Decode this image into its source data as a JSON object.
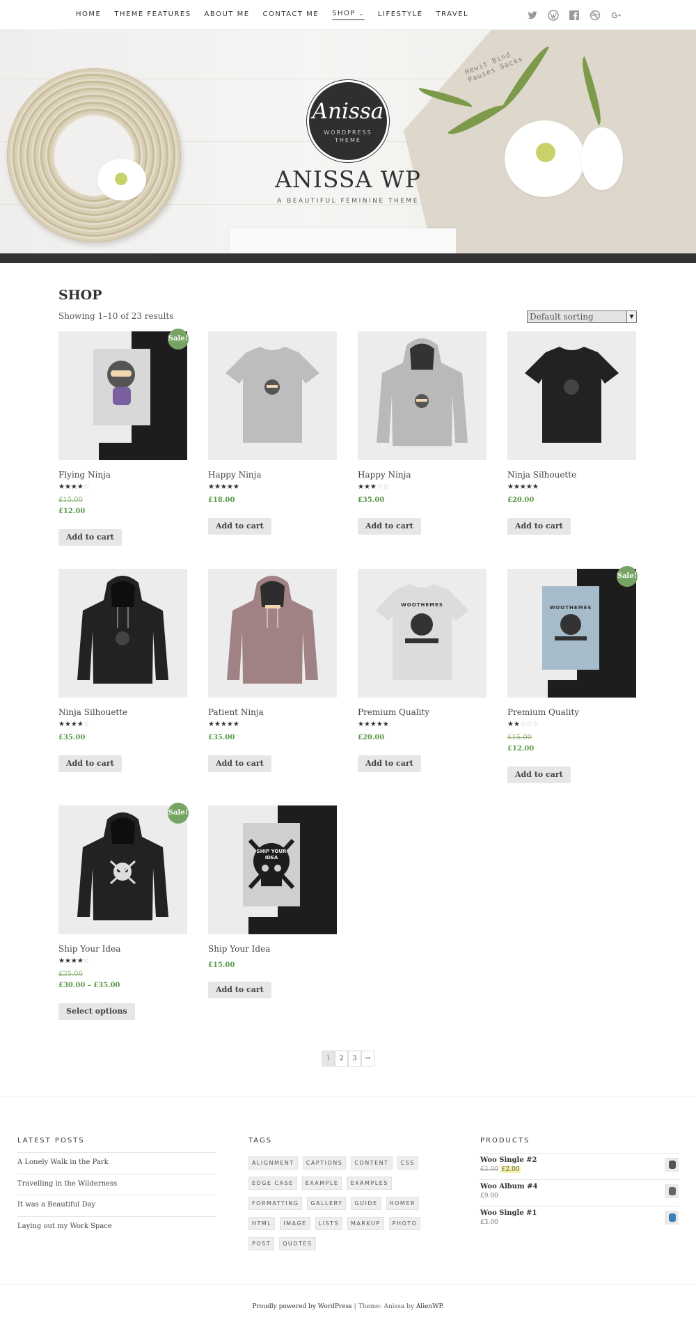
{
  "nav": {
    "items": [
      {
        "label": "HOME",
        "active": false
      },
      {
        "label": "THEME FEATURES",
        "active": false
      },
      {
        "label": "ABOUT ME",
        "active": false
      },
      {
        "label": "CONTACT ME",
        "active": false
      },
      {
        "label": "SHOP",
        "active": true,
        "has_dropdown": true
      },
      {
        "label": "LIFESTYLE",
        "active": false
      },
      {
        "label": "TRAVEL",
        "active": false
      }
    ],
    "social": [
      "twitter-icon",
      "wordpress-icon",
      "facebook-icon",
      "dribbble-icon",
      "google-plus-icon"
    ]
  },
  "hero": {
    "logo_name": "Anissa",
    "logo_sub_1": "WORDPRESS",
    "logo_sub_2": "THEME",
    "title": "ANISSA WP",
    "tagline": "A BEAUTIFUL FEMININE THEME",
    "cloth_line_1": "Hewit Bind",
    "cloth_line_2": "Pauses Sacks"
  },
  "shop": {
    "title": "SHOP",
    "result_count": "Showing 1–10 of 23 results",
    "sorting": "Default sorting",
    "products": [
      {
        "name": "Flying Ninja",
        "rating": 4,
        "price_old": "£15.00",
        "price": "£12.00",
        "button": "Add to cart",
        "sale": "Sale!",
        "art": "poster-ninja"
      },
      {
        "name": "Happy Ninja",
        "rating": 5,
        "price_old": "",
        "price": "£18.00",
        "button": "Add to cart",
        "sale": "",
        "art": "tshirt-grey"
      },
      {
        "name": "Happy Ninja",
        "rating": 3,
        "price_old": "",
        "price": "£35.00",
        "button": "Add to cart",
        "sale": "",
        "art": "hoodie-grey"
      },
      {
        "name": "Ninja Silhouette",
        "rating": 5,
        "price_old": "",
        "price": "£20.00",
        "button": "Add to cart",
        "sale": "",
        "art": "tshirt-black"
      },
      {
        "name": "Ninja Silhouette",
        "rating": 4,
        "price_old": "",
        "price": "£35.00",
        "button": "Add to cart",
        "sale": "",
        "art": "hoodie-black"
      },
      {
        "name": "Patient Ninja",
        "rating": 5,
        "price_old": "",
        "price": "£35.00",
        "button": "Add to cart",
        "sale": "",
        "art": "hoodie-mauve"
      },
      {
        "name": "Premium Quality",
        "rating": 5,
        "price_old": "",
        "price": "£20.00",
        "button": "Add to cart",
        "sale": "",
        "art": "tshirt-white"
      },
      {
        "name": "Premium Quality",
        "rating": 2,
        "price_old": "£15.00",
        "price": "£12.00",
        "button": "Add to cart",
        "sale": "Sale!",
        "art": "poster-blue"
      },
      {
        "name": "Ship Your Idea",
        "rating": 4,
        "price_old": "£35.00",
        "price": "£30.00 – £35.00",
        "button": "Select options",
        "sale": "Sale!",
        "art": "hoodie-skull"
      },
      {
        "name": "Ship Your Idea",
        "rating": 0,
        "price_old": "",
        "price": "£15.00",
        "button": "Add to cart",
        "sale": "",
        "art": "poster-skull"
      }
    ],
    "poster_skull_text_1": "SHIP YOUR",
    "poster_skull_text_2": "IDEA",
    "woo_text": "WOOTHEMES"
  },
  "pagination": {
    "pages": [
      "1",
      "2",
      "3"
    ],
    "next": "→",
    "current": "1"
  },
  "footer": {
    "latest_posts": {
      "title": "LATEST POSTS",
      "items": [
        "A Lonely Walk in the Park",
        "Travelling in the Wilderness",
        "It was a Beautiful Day",
        "Laying out my Work Space"
      ]
    },
    "tags": {
      "title": "TAGS",
      "items": [
        "ALIGNMENT",
        "CAPTIONS",
        "CONTENT",
        "CSS",
        "EDGE CASE",
        "EXAMPLE",
        "EXAMPLES",
        "FORMATTING",
        "GALLERY",
        "GUIDE",
        "HOMER",
        "HTML",
        "IMAGE",
        "LISTS",
        "MARKUP",
        "PHOTO",
        "POST",
        "QUOTES"
      ]
    },
    "products": {
      "title": "PRODUCTS",
      "items": [
        {
          "name": "Woo Single #2",
          "price_old": "£3.00",
          "price": "£2.00",
          "thumb_color": "#555"
        },
        {
          "name": "Woo Album #4",
          "price_old": "",
          "price": "£9.00",
          "thumb_color": "#666"
        },
        {
          "name": "Woo Single #1",
          "price_old": "",
          "price": "£3.00",
          "thumb_color": "#3a7fb5"
        }
      ]
    }
  },
  "credits": {
    "powered": "Proudly powered by WordPress",
    "separator": " | ",
    "theme": "Theme: Anissa by ",
    "author": "AlienWP."
  }
}
